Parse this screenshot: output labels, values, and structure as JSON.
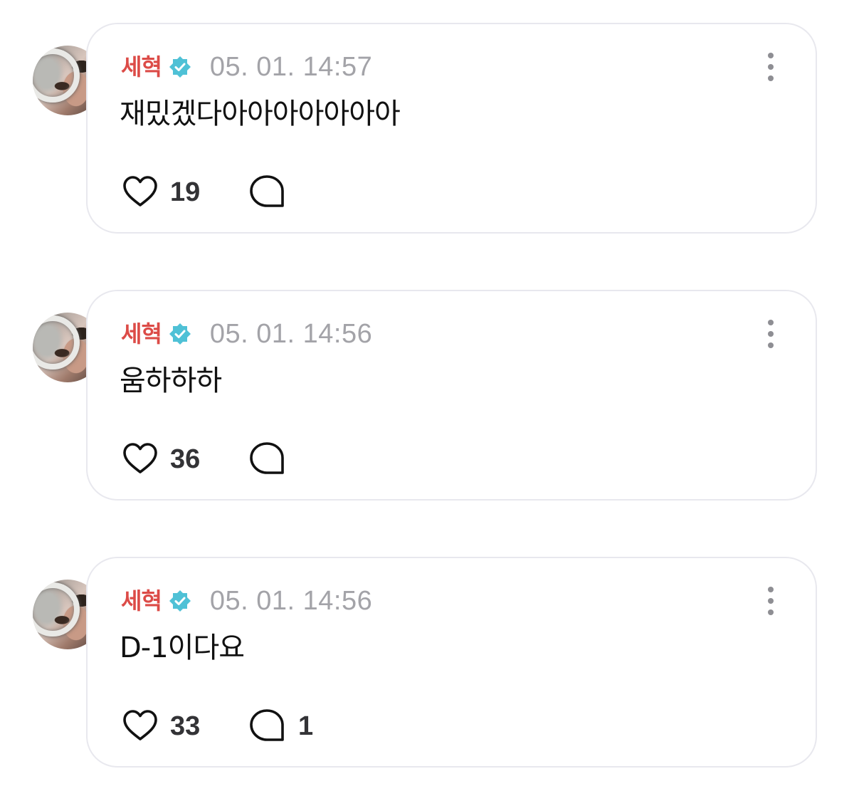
{
  "colors": {
    "author": "#dc4b47",
    "verified_badge": "#4fc1d6",
    "timestamp": "#a3a3a8",
    "card_border": "#e8e8ee",
    "icon": "#111111"
  },
  "icons": {
    "verified": "verified-badge-icon",
    "more": "more-vertical-icon",
    "like": "heart-outline-icon",
    "reply": "speech-bubble-icon"
  },
  "posts": [
    {
      "author": "세혁",
      "timestamp": "05. 01. 14:57",
      "text": "재밌겠다아아아아아아아",
      "likes": "19",
      "replies": ""
    },
    {
      "author": "세혁",
      "timestamp": "05. 01. 14:56",
      "text": "움하하하",
      "likes": "36",
      "replies": ""
    },
    {
      "author": "세혁",
      "timestamp": "05. 01. 14:56",
      "text": "D-1이다요",
      "likes": "33",
      "replies": "1"
    }
  ]
}
